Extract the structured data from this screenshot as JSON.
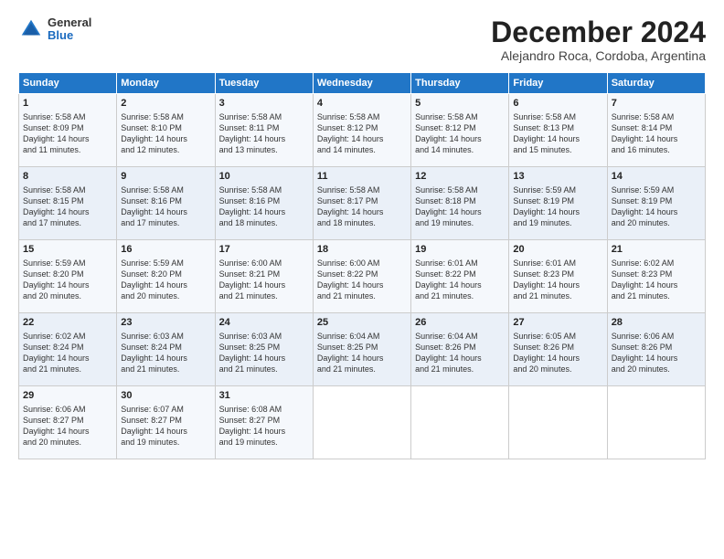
{
  "logo": {
    "general": "General",
    "blue": "Blue"
  },
  "header": {
    "title": "December 2024",
    "subtitle": "Alejandro Roca, Cordoba, Argentina"
  },
  "columns": [
    "Sunday",
    "Monday",
    "Tuesday",
    "Wednesday",
    "Thursday",
    "Friday",
    "Saturday"
  ],
  "weeks": [
    [
      {
        "day": 1,
        "lines": [
          "Sunrise: 5:58 AM",
          "Sunset: 8:09 PM",
          "Daylight: 14 hours",
          "and 11 minutes."
        ]
      },
      {
        "day": 2,
        "lines": [
          "Sunrise: 5:58 AM",
          "Sunset: 8:10 PM",
          "Daylight: 14 hours",
          "and 12 minutes."
        ]
      },
      {
        "day": 3,
        "lines": [
          "Sunrise: 5:58 AM",
          "Sunset: 8:11 PM",
          "Daylight: 14 hours",
          "and 13 minutes."
        ]
      },
      {
        "day": 4,
        "lines": [
          "Sunrise: 5:58 AM",
          "Sunset: 8:12 PM",
          "Daylight: 14 hours",
          "and 14 minutes."
        ]
      },
      {
        "day": 5,
        "lines": [
          "Sunrise: 5:58 AM",
          "Sunset: 8:12 PM",
          "Daylight: 14 hours",
          "and 14 minutes."
        ]
      },
      {
        "day": 6,
        "lines": [
          "Sunrise: 5:58 AM",
          "Sunset: 8:13 PM",
          "Daylight: 14 hours",
          "and 15 minutes."
        ]
      },
      {
        "day": 7,
        "lines": [
          "Sunrise: 5:58 AM",
          "Sunset: 8:14 PM",
          "Daylight: 14 hours",
          "and 16 minutes."
        ]
      }
    ],
    [
      {
        "day": 8,
        "lines": [
          "Sunrise: 5:58 AM",
          "Sunset: 8:15 PM",
          "Daylight: 14 hours",
          "and 17 minutes."
        ]
      },
      {
        "day": 9,
        "lines": [
          "Sunrise: 5:58 AM",
          "Sunset: 8:16 PM",
          "Daylight: 14 hours",
          "and 17 minutes."
        ]
      },
      {
        "day": 10,
        "lines": [
          "Sunrise: 5:58 AM",
          "Sunset: 8:16 PM",
          "Daylight: 14 hours",
          "and 18 minutes."
        ]
      },
      {
        "day": 11,
        "lines": [
          "Sunrise: 5:58 AM",
          "Sunset: 8:17 PM",
          "Daylight: 14 hours",
          "and 18 minutes."
        ]
      },
      {
        "day": 12,
        "lines": [
          "Sunrise: 5:58 AM",
          "Sunset: 8:18 PM",
          "Daylight: 14 hours",
          "and 19 minutes."
        ]
      },
      {
        "day": 13,
        "lines": [
          "Sunrise: 5:59 AM",
          "Sunset: 8:19 PM",
          "Daylight: 14 hours",
          "and 19 minutes."
        ]
      },
      {
        "day": 14,
        "lines": [
          "Sunrise: 5:59 AM",
          "Sunset: 8:19 PM",
          "Daylight: 14 hours",
          "and 20 minutes."
        ]
      }
    ],
    [
      {
        "day": 15,
        "lines": [
          "Sunrise: 5:59 AM",
          "Sunset: 8:20 PM",
          "Daylight: 14 hours",
          "and 20 minutes."
        ]
      },
      {
        "day": 16,
        "lines": [
          "Sunrise: 5:59 AM",
          "Sunset: 8:20 PM",
          "Daylight: 14 hours",
          "and 20 minutes."
        ]
      },
      {
        "day": 17,
        "lines": [
          "Sunrise: 6:00 AM",
          "Sunset: 8:21 PM",
          "Daylight: 14 hours",
          "and 21 minutes."
        ]
      },
      {
        "day": 18,
        "lines": [
          "Sunrise: 6:00 AM",
          "Sunset: 8:22 PM",
          "Daylight: 14 hours",
          "and 21 minutes."
        ]
      },
      {
        "day": 19,
        "lines": [
          "Sunrise: 6:01 AM",
          "Sunset: 8:22 PM",
          "Daylight: 14 hours",
          "and 21 minutes."
        ]
      },
      {
        "day": 20,
        "lines": [
          "Sunrise: 6:01 AM",
          "Sunset: 8:23 PM",
          "Daylight: 14 hours",
          "and 21 minutes."
        ]
      },
      {
        "day": 21,
        "lines": [
          "Sunrise: 6:02 AM",
          "Sunset: 8:23 PM",
          "Daylight: 14 hours",
          "and 21 minutes."
        ]
      }
    ],
    [
      {
        "day": 22,
        "lines": [
          "Sunrise: 6:02 AM",
          "Sunset: 8:24 PM",
          "Daylight: 14 hours",
          "and 21 minutes."
        ]
      },
      {
        "day": 23,
        "lines": [
          "Sunrise: 6:03 AM",
          "Sunset: 8:24 PM",
          "Daylight: 14 hours",
          "and 21 minutes."
        ]
      },
      {
        "day": 24,
        "lines": [
          "Sunrise: 6:03 AM",
          "Sunset: 8:25 PM",
          "Daylight: 14 hours",
          "and 21 minutes."
        ]
      },
      {
        "day": 25,
        "lines": [
          "Sunrise: 6:04 AM",
          "Sunset: 8:25 PM",
          "Daylight: 14 hours",
          "and 21 minutes."
        ]
      },
      {
        "day": 26,
        "lines": [
          "Sunrise: 6:04 AM",
          "Sunset: 8:26 PM",
          "Daylight: 14 hours",
          "and 21 minutes."
        ]
      },
      {
        "day": 27,
        "lines": [
          "Sunrise: 6:05 AM",
          "Sunset: 8:26 PM",
          "Daylight: 14 hours",
          "and 20 minutes."
        ]
      },
      {
        "day": 28,
        "lines": [
          "Sunrise: 6:06 AM",
          "Sunset: 8:26 PM",
          "Daylight: 14 hours",
          "and 20 minutes."
        ]
      }
    ],
    [
      {
        "day": 29,
        "lines": [
          "Sunrise: 6:06 AM",
          "Sunset: 8:27 PM",
          "Daylight: 14 hours",
          "and 20 minutes."
        ]
      },
      {
        "day": 30,
        "lines": [
          "Sunrise: 6:07 AM",
          "Sunset: 8:27 PM",
          "Daylight: 14 hours",
          "and 19 minutes."
        ]
      },
      {
        "day": 31,
        "lines": [
          "Sunrise: 6:08 AM",
          "Sunset: 8:27 PM",
          "Daylight: 14 hours",
          "and 19 minutes."
        ]
      },
      null,
      null,
      null,
      null
    ]
  ]
}
